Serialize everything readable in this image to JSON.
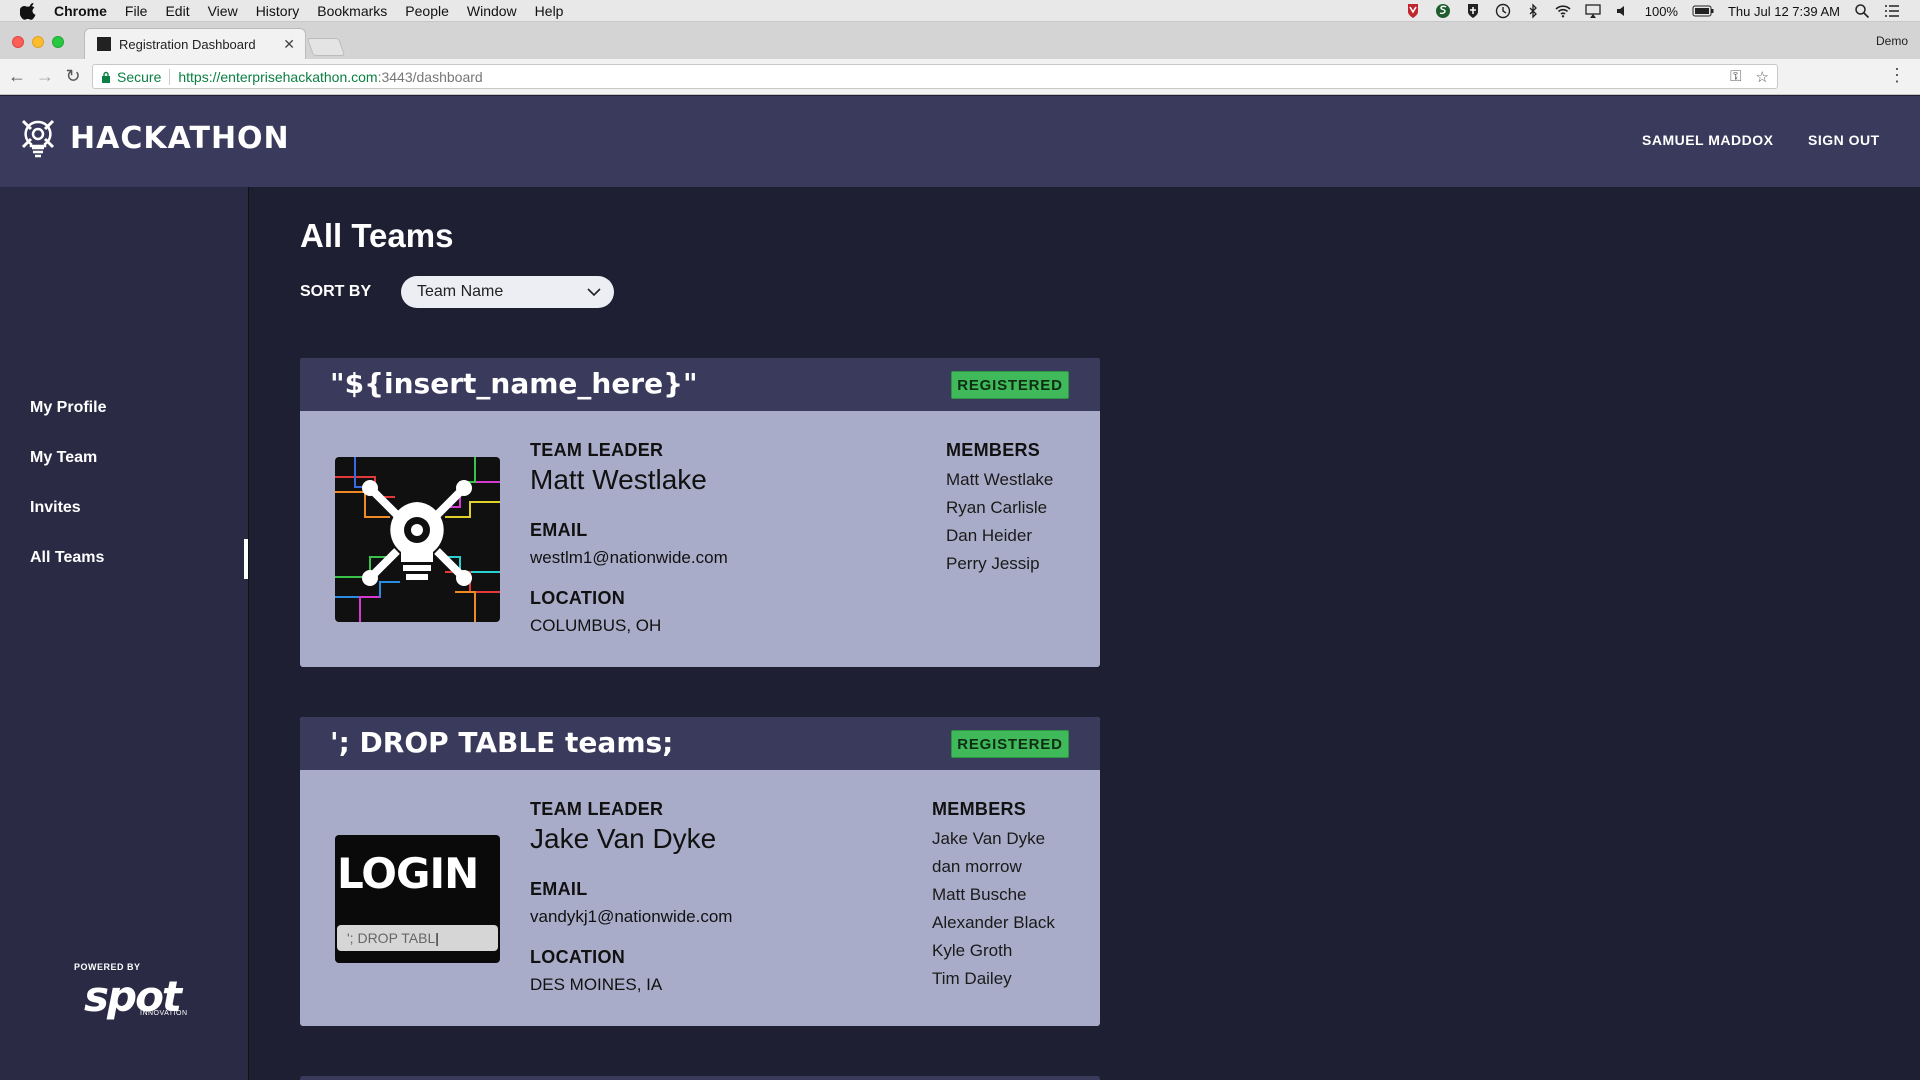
{
  "menubar": {
    "app": "Chrome",
    "items": [
      "File",
      "Edit",
      "View",
      "History",
      "Bookmarks",
      "People",
      "Window",
      "Help"
    ],
    "battery": "100%",
    "datetime": "Thu Jul 12  7:39 AM"
  },
  "browser": {
    "tab_title": "Registration Dashboard",
    "profile": "Demo",
    "secure_label": "Secure",
    "url_host": "https://enterprisehackathon.com",
    "url_rest": ":3443/dashboard"
  },
  "header": {
    "brand": "HACKATHON",
    "user_name": "SAMUEL MADDOX",
    "sign_out": "SIGN OUT"
  },
  "sidebar": {
    "items": [
      {
        "label": "My Profile"
      },
      {
        "label": "My Team"
      },
      {
        "label": "Invites"
      },
      {
        "label": "All Teams"
      }
    ],
    "active": "All Teams",
    "powered_by": "POWERED BY",
    "brand": "spot",
    "brand_sub": "INNOVATION"
  },
  "main": {
    "title": "All Teams",
    "sort_label": "SORT BY",
    "sort_value": "Team Name",
    "teams": [
      {
        "name": "\"${insert_name_here}\"",
        "status": "REGISTERED",
        "leader_label": "TEAM LEADER",
        "leader": "Matt Westlake",
        "email_label": "EMAIL",
        "email": "westlm1@nationwide.com",
        "location_label": "LOCATION",
        "location": "COLUMBUS, OH",
        "members_label": "MEMBERS",
        "members": [
          "Matt Westlake",
          "Ryan Carlisle",
          "Dan Heider",
          "Perry Jessip"
        ]
      },
      {
        "name": "'; DROP TABLE teams;",
        "status": "REGISTERED",
        "leader_label": "TEAM LEADER",
        "leader": "Jake Van Dyke",
        "email_label": "EMAIL",
        "email": "vandykj1@nationwide.com",
        "location_label": "LOCATION",
        "location": "DES MOINES, IA",
        "members_label": "MEMBERS",
        "members": [
          "Jake Van Dyke",
          "dan morrow",
          "Matt Busche",
          "Alexander Black",
          "Kyle Groth",
          "Tim Dailey"
        ],
        "image_text": "LOGIN",
        "image_input": "'; DROP TABL"
      }
    ]
  },
  "colors": {
    "header_bg": "#3a3a5c",
    "page_bg": "#1f1f33",
    "sidebar_bg": "#2a2a45",
    "card_bg": "#a9acc9",
    "badge_bg": "#3fb95a"
  }
}
